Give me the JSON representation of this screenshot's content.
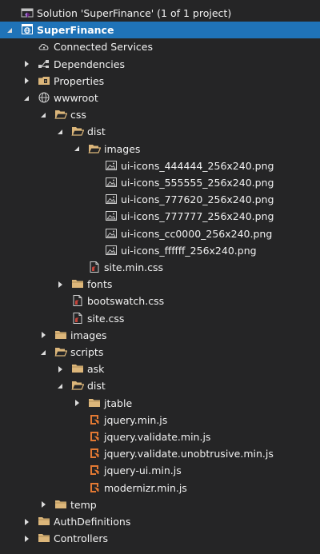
{
  "solution_label": "Solution 'SuperFinance' (1 of 1 project)",
  "colors": {
    "background": "#252526",
    "selection": "#1f73b8",
    "folder": "#dcb67a",
    "text": "#f1f1f1",
    "orange": "#e37933",
    "css_red": "#c5443a"
  },
  "items": [
    {
      "label": "Solution 'SuperFinance' (1 of 1 project)",
      "icon": "solution-icon",
      "level": 0,
      "expander": "none",
      "name": "solution-node"
    },
    {
      "label": "SuperFinance",
      "icon": "web-project-icon",
      "level": 0,
      "expander": "open",
      "name": "project-superfinance",
      "selected": true
    },
    {
      "label": "Connected Services",
      "icon": "cloud-icon",
      "level": 1,
      "expander": "none",
      "name": "node-connected-services"
    },
    {
      "label": "Dependencies",
      "icon": "dependencies-icon",
      "level": 1,
      "expander": "closed",
      "name": "node-dependencies"
    },
    {
      "label": "Properties",
      "icon": "properties-icon",
      "level": 1,
      "expander": "closed",
      "name": "node-properties"
    },
    {
      "label": "wwwroot",
      "icon": "globe-icon",
      "level": 1,
      "expander": "open",
      "name": "node-wwwroot"
    },
    {
      "label": "css",
      "icon": "folder-open-icon",
      "level": 2,
      "expander": "open",
      "name": "folder-css"
    },
    {
      "label": "dist",
      "icon": "folder-open-icon",
      "level": 3,
      "expander": "open",
      "name": "folder-css-dist"
    },
    {
      "label": "images",
      "icon": "folder-open-icon",
      "level": 4,
      "expander": "open",
      "name": "folder-css-dist-images"
    },
    {
      "label": "ui-icons_444444_256x240.png",
      "icon": "image-file-icon",
      "level": 5,
      "expander": "none",
      "name": "file-ui-icons-444444"
    },
    {
      "label": "ui-icons_555555_256x240.png",
      "icon": "image-file-icon",
      "level": 5,
      "expander": "none",
      "name": "file-ui-icons-555555"
    },
    {
      "label": "ui-icons_777620_256x240.png",
      "icon": "image-file-icon",
      "level": 5,
      "expander": "none",
      "name": "file-ui-icons-777620"
    },
    {
      "label": "ui-icons_777777_256x240.png",
      "icon": "image-file-icon",
      "level": 5,
      "expander": "none",
      "name": "file-ui-icons-777777"
    },
    {
      "label": "ui-icons_cc0000_256x240.png",
      "icon": "image-file-icon",
      "level": 5,
      "expander": "none",
      "name": "file-ui-icons-cc0000"
    },
    {
      "label": "ui-icons_ffffff_256x240.png",
      "icon": "image-file-icon",
      "level": 5,
      "expander": "none",
      "name": "file-ui-icons-ffffff"
    },
    {
      "label": "site.min.css",
      "icon": "css-file-icon",
      "level": 4,
      "expander": "none",
      "name": "file-site-min-css"
    },
    {
      "label": "fonts",
      "icon": "folder-icon",
      "level": 3,
      "expander": "closed",
      "name": "folder-fonts"
    },
    {
      "label": "bootswatch.css",
      "icon": "css-file-icon",
      "level": 3,
      "expander": "none",
      "name": "file-bootswatch-css"
    },
    {
      "label": "site.css",
      "icon": "css-file-icon",
      "level": 3,
      "expander": "none",
      "name": "file-site-css"
    },
    {
      "label": "images",
      "icon": "folder-icon",
      "level": 2,
      "expander": "closed",
      "name": "folder-images"
    },
    {
      "label": "scripts",
      "icon": "folder-open-icon",
      "level": 2,
      "expander": "open",
      "name": "folder-scripts"
    },
    {
      "label": "ask",
      "icon": "folder-icon",
      "level": 3,
      "expander": "closed",
      "name": "folder-ask"
    },
    {
      "label": "dist",
      "icon": "folder-open-icon",
      "level": 3,
      "expander": "open",
      "name": "folder-scripts-dist"
    },
    {
      "label": "jtable",
      "icon": "folder-icon",
      "level": 4,
      "expander": "closed",
      "name": "folder-jtable"
    },
    {
      "label": "jquery.min.js",
      "icon": "js-file-icon",
      "level": 4,
      "expander": "none",
      "name": "file-jquery-min-js"
    },
    {
      "label": "jquery.validate.min.js",
      "icon": "js-file-icon",
      "level": 4,
      "expander": "none",
      "name": "file-jquery-validate-min-js"
    },
    {
      "label": "jquery.validate.unobtrusive.min.js",
      "icon": "js-file-icon",
      "level": 4,
      "expander": "none",
      "name": "file-jquery-validate-unobtrusive-min-js"
    },
    {
      "label": "jquery-ui.min.js",
      "icon": "js-file-icon",
      "level": 4,
      "expander": "none",
      "name": "file-jquery-ui-min-js"
    },
    {
      "label": "modernizr.min.js",
      "icon": "js-file-icon",
      "level": 4,
      "expander": "none",
      "name": "file-modernizr-min-js"
    },
    {
      "label": "temp",
      "icon": "folder-icon",
      "level": 2,
      "expander": "closed",
      "name": "folder-temp"
    },
    {
      "label": "AuthDefinitions",
      "icon": "folder-icon",
      "level": 1,
      "expander": "closed",
      "name": "folder-authdefinitions"
    },
    {
      "label": "Controllers",
      "icon": "folder-icon",
      "level": 1,
      "expander": "closed",
      "name": "folder-controllers"
    }
  ]
}
